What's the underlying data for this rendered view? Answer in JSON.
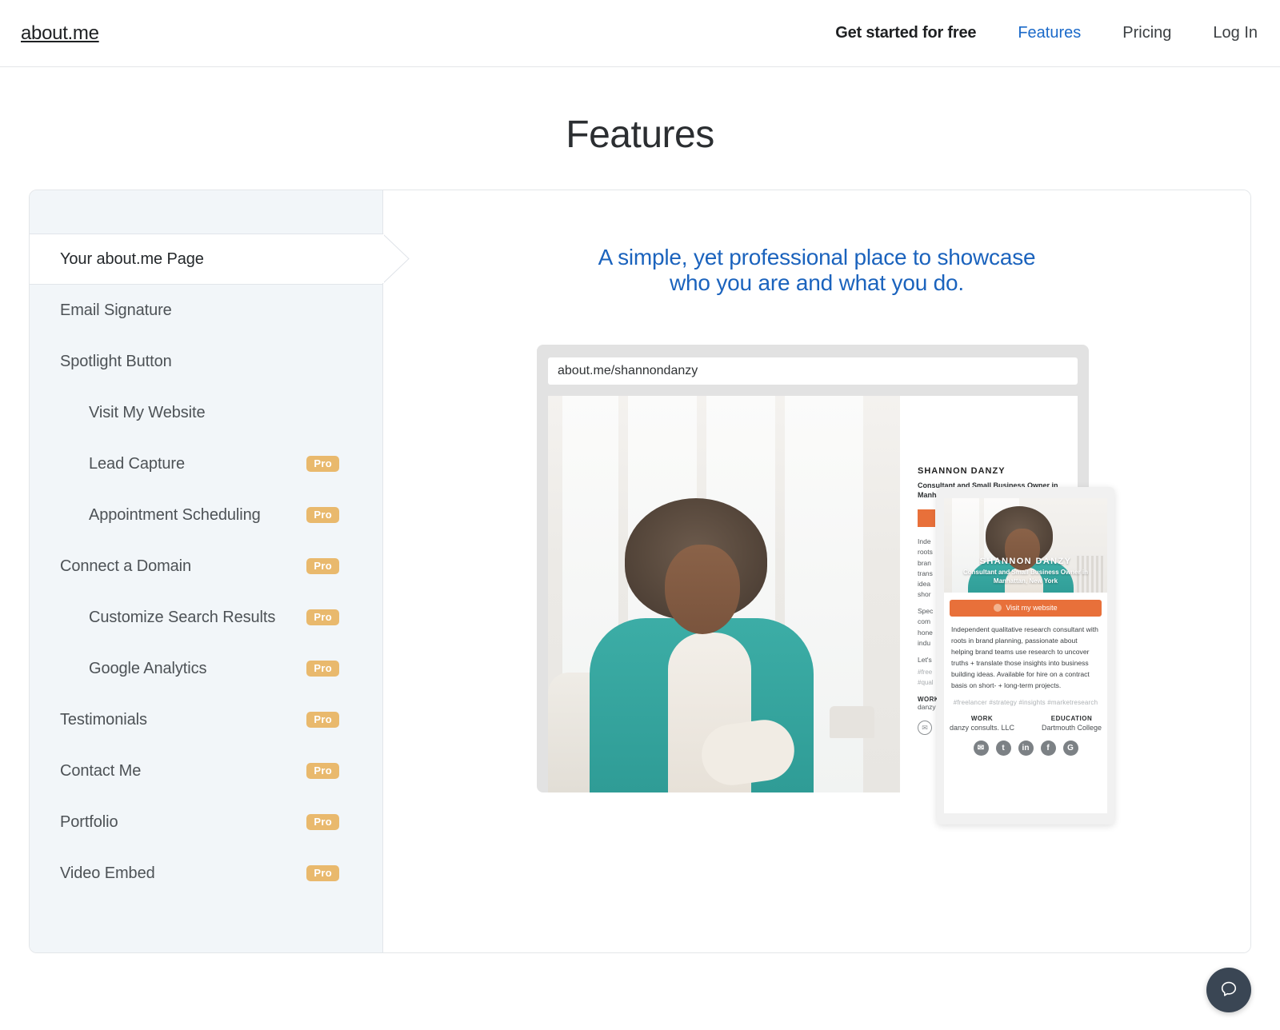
{
  "header": {
    "brand": "about.me",
    "nav": [
      {
        "label": "Get started for free",
        "style": "cta"
      },
      {
        "label": "Features",
        "style": "active"
      },
      {
        "label": "Pricing",
        "style": "plain"
      },
      {
        "label": "Log In",
        "style": "plain"
      }
    ]
  },
  "page": {
    "title": "Features"
  },
  "sidebar": {
    "items": [
      {
        "label": "Your about.me Page",
        "indent": false,
        "active": true,
        "pro": ""
      },
      {
        "label": "Email Signature",
        "indent": false,
        "active": false,
        "pro": ""
      },
      {
        "label": "Spotlight Button",
        "indent": false,
        "active": false,
        "pro": ""
      },
      {
        "label": "Visit My Website",
        "indent": true,
        "active": false,
        "pro": ""
      },
      {
        "label": "Lead Capture",
        "indent": true,
        "active": false,
        "pro": "Pro"
      },
      {
        "label": "Appointment Scheduling",
        "indent": true,
        "active": false,
        "pro": "Pro"
      },
      {
        "label": "Connect a Domain",
        "indent": false,
        "active": false,
        "pro": "Pro"
      },
      {
        "label": "Customize Search Results",
        "indent": true,
        "active": false,
        "pro": "Pro"
      },
      {
        "label": "Google Analytics",
        "indent": true,
        "active": false,
        "pro": "Pro"
      },
      {
        "label": "Testimonials",
        "indent": false,
        "active": false,
        "pro": "Pro"
      },
      {
        "label": "Contact Me",
        "indent": false,
        "active": false,
        "pro": "Pro"
      },
      {
        "label": "Portfolio",
        "indent": false,
        "active": false,
        "pro": "Pro"
      },
      {
        "label": "Video Embed",
        "indent": false,
        "active": false,
        "pro": "Pro"
      }
    ]
  },
  "panel": {
    "tagline_line1": "A simple, yet professional place to showcase",
    "tagline_line2": "who you are and what you do.",
    "browser": {
      "url": "about.me/shannondanzy"
    },
    "desktop_preview": {
      "name": "SHANNON DANZY",
      "title": "Consultant and Small Business Owner in Manhattan, New York",
      "bio_fragments": [
        "Inde",
        "roots",
        "bran",
        "trans",
        "idea",
        "shor"
      ],
      "bio_fragments2": [
        "Spec",
        "com",
        "hone",
        "indu"
      ],
      "closing_fragment": "Let's",
      "tag_fragment1": "#free",
      "tag_fragment2": "#qual",
      "work_heading": "WORK",
      "work_fragment": "danzy"
    },
    "mobile_preview": {
      "name": "SHANNON DANZY",
      "title": "Consultant and Small Business Owner in Manhattan, New York",
      "button_label": "Visit my website",
      "bio": "Independent qualitative research consultant with roots in brand planning, passionate about helping brand teams use research to uncover truths + translate those insights into business building ideas. Available for hire on a contract basis on short- + long-term projects.",
      "tags": "#freelancer  #strategy  #insights  #marketresearch",
      "work_heading": "WORK",
      "work_value": "danzy consults. LLC",
      "education_heading": "EDUCATION",
      "education_value": "Dartmouth College",
      "socials": [
        {
          "name": "email-icon",
          "glyph": "✉"
        },
        {
          "name": "twitter-icon",
          "glyph": "t"
        },
        {
          "name": "linkedin-icon",
          "glyph": "in"
        },
        {
          "name": "facebook-icon",
          "glyph": "f"
        },
        {
          "name": "googleplus-icon",
          "glyph": "G"
        }
      ]
    }
  },
  "chat": {
    "label": "chat-bubble-icon"
  },
  "colors": {
    "accent_blue": "#1b63bd",
    "nav_link_blue": "#1b6ac9",
    "pro_badge": "#e9b96d",
    "orange": "#e8703a",
    "sidebar_bg": "#f2f6f9",
    "chat_bg": "#3a4654"
  }
}
